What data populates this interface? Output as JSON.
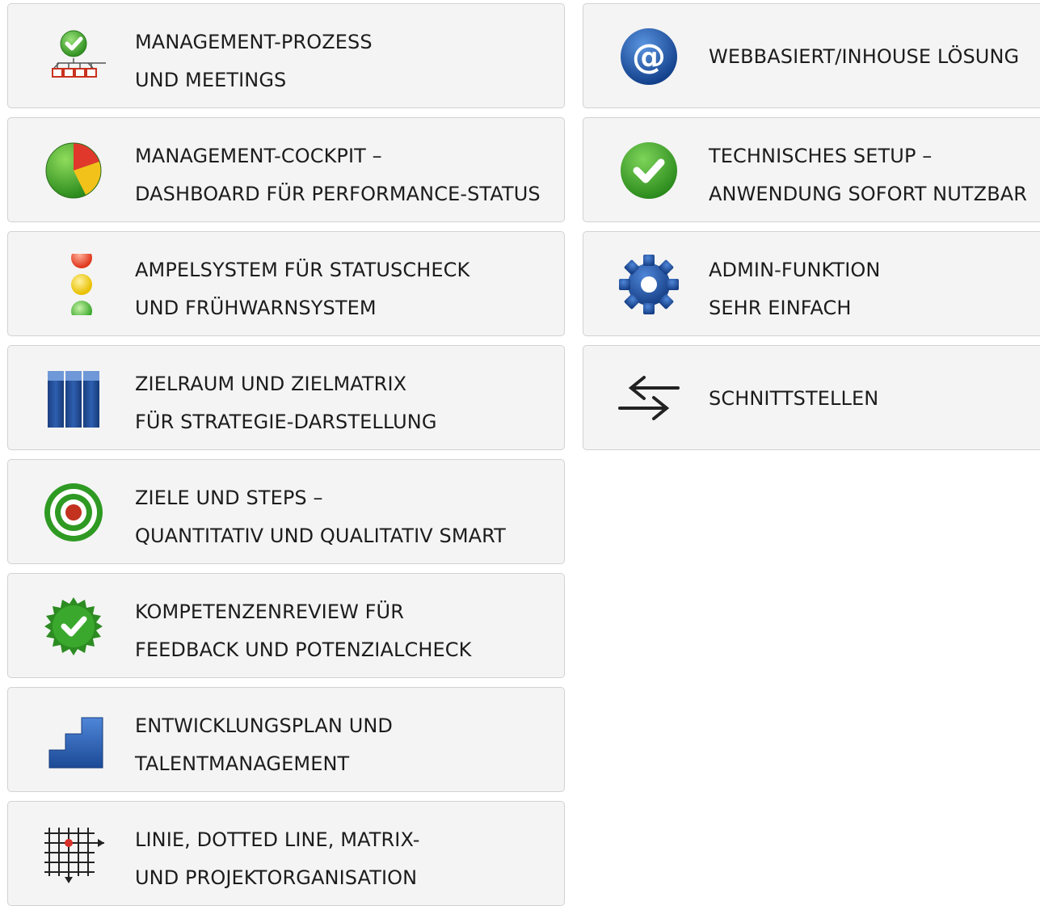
{
  "left_features": [
    {
      "icon": "org-chart-check-icon",
      "line1": "MANAGEMENT-PROZESS",
      "line2": "UND MEETINGS"
    },
    {
      "icon": "pie-chart-icon",
      "line1": "MANAGEMENT-COCKPIT –",
      "line2": "DASHBOARD FÜR PERFORMANCE-STATUS"
    },
    {
      "icon": "traffic-light-icon",
      "line1": "AMPELSYSTEM FÜR STATUSCHECK",
      "line2": "UND FRÜHWARNSYSTEM"
    },
    {
      "icon": "columns-icon",
      "line1": "ZIELRAUM UND ZIELMATRIX",
      "line2": "FÜR STRATEGIE-DARSTELLUNG"
    },
    {
      "icon": "target-icon",
      "line1": "ZIELE UND STEPS –",
      "line2": "QUANTITATIV UND QUALITATIV SMART"
    },
    {
      "icon": "badge-check-icon",
      "line1": "KOMPETENZENREVIEW FÜR",
      "line2": "FEEDBACK UND POTENZIALCHECK"
    },
    {
      "icon": "stairs-icon",
      "line1": "ENTWICKLUNGSPLAN UND",
      "line2": "TALENTMANAGEMENT"
    },
    {
      "icon": "grid-matrix-icon",
      "line1": "LINIE, DOTTED LINE, MATRIX-",
      "line2": "UND PROJEKTORGANISATION"
    }
  ],
  "right_features": [
    {
      "icon": "at-sign-icon",
      "line1": "WEBBASIERT/INHOUSE LÖSUNG"
    },
    {
      "icon": "check-circle-icon",
      "line1": "TECHNISCHES SETUP –",
      "line2": "ANWENDUNG SOFORT NUTZBAR"
    },
    {
      "icon": "gear-icon",
      "line1": "ADMIN-FUNKTION",
      "line2": "SEHR EINFACH"
    },
    {
      "icon": "exchange-arrows-icon",
      "line1": "SCHNITTSTELLEN"
    }
  ],
  "colors": {
    "card_bg": "#f4f4f4",
    "card_border": "#d2d2d2",
    "text": "#1c1c1c",
    "green": "#3aa82c",
    "blue": "#1f4f9c",
    "red": "#d8452b",
    "yellow": "#f2c21b"
  }
}
